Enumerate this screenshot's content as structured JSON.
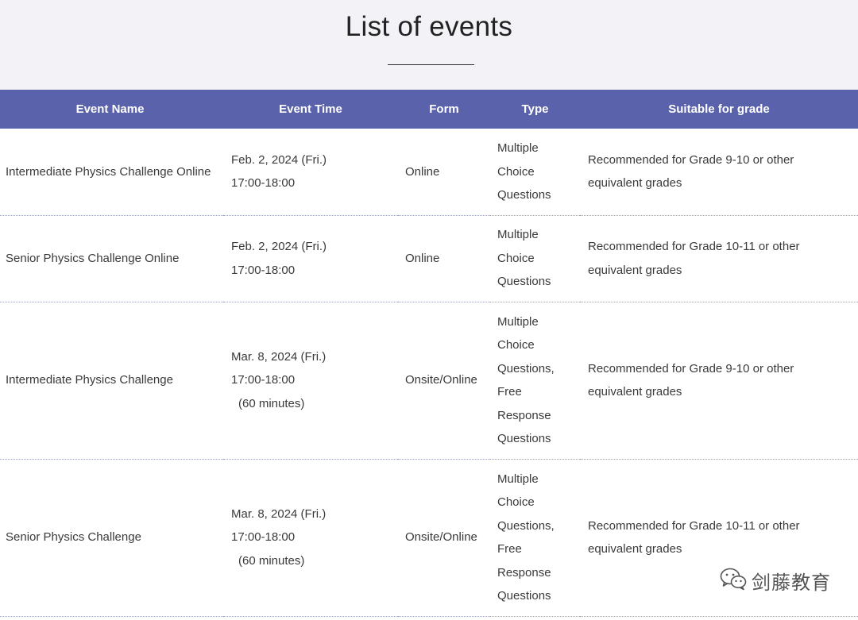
{
  "header": {
    "title": "List of events"
  },
  "table": {
    "columns": [
      "Event Name",
      "Event Time",
      "Form",
      "Type",
      "Suitable for grade"
    ],
    "rows": [
      {
        "name": "Intermediate Physics Challenge Online",
        "date": "Feb. 2, 2024 (Fri.)",
        "time": "17:00-18:00",
        "duration": "",
        "form": "Online",
        "type": "Multiple Choice Questions",
        "grade": "Recommended for Grade 9-10 or other equivalent grades"
      },
      {
        "name": "Senior Physics Challenge Online",
        "date": "Feb. 2, 2024 (Fri.)",
        "time": "17:00-18:00",
        "duration": "",
        "form": "Online",
        "type": "Multiple Choice Questions",
        "grade": "Recommended for Grade 10-11 or other equivalent grades"
      },
      {
        "name": "Intermediate Physics Challenge",
        "date": "Mar. 8, 2024 (Fri.)",
        "time": "17:00-18:00",
        "duration": "(60 minutes)",
        "form": "Onsite/Online",
        "type": "Multiple Choice Questions, Free Response Questions",
        "grade": "Recommended for Grade 9-10 or other equivalent grades"
      },
      {
        "name": "Senior Physics Challenge",
        "date": "Mar. 8, 2024 (Fri.)",
        "time": "17:00-18:00",
        "duration": "(60 minutes)",
        "form": "Onsite/Online",
        "type": "Multiple Choice Questions, Free Response Questions",
        "grade": "Recommended for Grade 10-11 or other equivalent grades"
      }
    ]
  },
  "watermark": {
    "text": "剑藤教育",
    "icon": "wechat-icon"
  }
}
